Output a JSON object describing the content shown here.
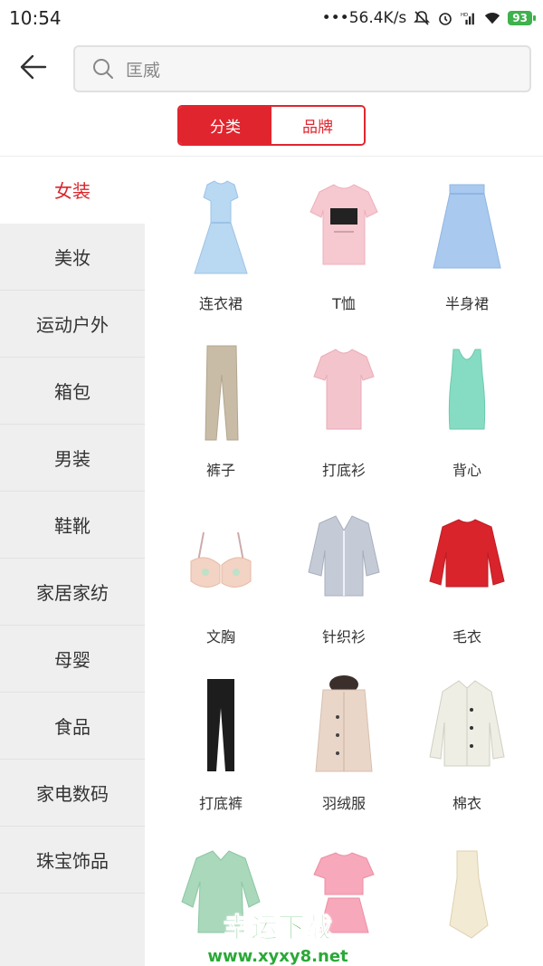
{
  "status_bar": {
    "time": "10:54",
    "network_speed": "•••56.4K/s",
    "battery_level": "93",
    "icons": [
      "mute-icon",
      "alarm-icon",
      "hd-signal-icon",
      "wifi-icon",
      "battery-icon"
    ]
  },
  "header": {
    "back_icon": "back-arrow-icon",
    "search": {
      "icon": "search-icon",
      "text": "匡威"
    }
  },
  "segment": {
    "tabs": [
      {
        "label": "分类",
        "active": true
      },
      {
        "label": "品牌",
        "active": false
      }
    ]
  },
  "sidebar": {
    "items": [
      {
        "label": "女装",
        "active": true
      },
      {
        "label": "美妆"
      },
      {
        "label": "运动户外"
      },
      {
        "label": "箱包"
      },
      {
        "label": "男装"
      },
      {
        "label": "鞋靴"
      },
      {
        "label": "家居家纺"
      },
      {
        "label": "母婴"
      },
      {
        "label": "食品"
      },
      {
        "label": "家电数码"
      },
      {
        "label": "珠宝饰品"
      }
    ]
  },
  "grid": {
    "items": [
      {
        "label": "连衣裙",
        "icon": "dress-icon"
      },
      {
        "label": "T恤",
        "icon": "tshirt-icon"
      },
      {
        "label": "半身裙",
        "icon": "skirt-icon"
      },
      {
        "label": "裤子",
        "icon": "pants-icon"
      },
      {
        "label": "打底衫",
        "icon": "base-shirt-icon"
      },
      {
        "label": "背心",
        "icon": "tank-top-icon"
      },
      {
        "label": "文胸",
        "icon": "bra-icon"
      },
      {
        "label": "针织衫",
        "icon": "cardigan-icon"
      },
      {
        "label": "毛衣",
        "icon": "sweater-icon"
      },
      {
        "label": "打底裤",
        "icon": "leggings-icon"
      },
      {
        "label": "羽绒服",
        "icon": "down-coat-icon"
      },
      {
        "label": "棉衣",
        "icon": "padded-jacket-icon"
      },
      {
        "label": "",
        "icon": "green-blouse-icon"
      },
      {
        "label": "",
        "icon": "pink-set-icon"
      },
      {
        "label": "",
        "icon": "white-top-icon"
      }
    ]
  },
  "watermark": {
    "title": "幸运下载",
    "url": "www.xyxy8.net"
  },
  "colors": {
    "accent": "#e1252e",
    "sidebar_bg": "#efefef"
  }
}
